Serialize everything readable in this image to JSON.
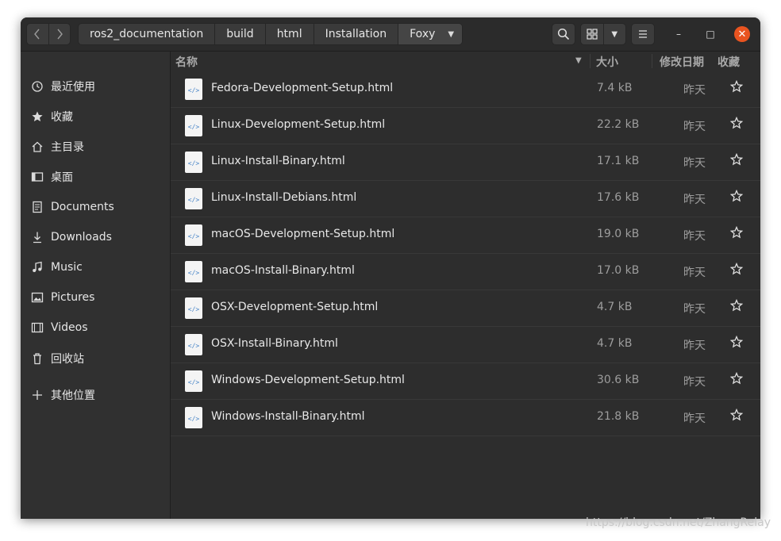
{
  "nav": {
    "back_icon": "chevron-left-icon",
    "forward_icon": "chevron-right-icon"
  },
  "path": [
    "ros2_documentation",
    "build",
    "html",
    "Installation",
    "Foxy"
  ],
  "toolbar": {
    "search_icon": "search-icon",
    "grid_icon": "grid-view-icon",
    "dropdown_icon": "chevron-down-icon",
    "menu_icon": "hamburger-menu-icon"
  },
  "window_controls": {
    "minimize": "–",
    "maximize": "□",
    "close": "✕"
  },
  "sidebar": {
    "items": [
      {
        "label": "最近使用",
        "icon": "clock-icon"
      },
      {
        "label": "收藏",
        "icon": "star-icon"
      },
      {
        "label": "主目录",
        "icon": "home-icon"
      },
      {
        "label": "桌面",
        "icon": "desktop-icon"
      },
      {
        "label": "Documents",
        "icon": "document-icon"
      },
      {
        "label": "Downloads",
        "icon": "download-icon"
      },
      {
        "label": "Music",
        "icon": "music-icon"
      },
      {
        "label": "Pictures",
        "icon": "picture-icon"
      },
      {
        "label": "Videos",
        "icon": "film-icon"
      },
      {
        "label": "回收站",
        "icon": "trash-icon"
      },
      {
        "label": "其他位置",
        "icon": "plus-icon"
      }
    ]
  },
  "columns": {
    "name": "名称",
    "size": "大小",
    "modified": "修改日期",
    "starred": "收藏"
  },
  "files": [
    {
      "name": "Fedora-Development-Setup.html",
      "size": "7.4 kB",
      "modified": "昨天"
    },
    {
      "name": "Linux-Development-Setup.html",
      "size": "22.2 kB",
      "modified": "昨天"
    },
    {
      "name": "Linux-Install-Binary.html",
      "size": "17.1 kB",
      "modified": "昨天"
    },
    {
      "name": "Linux-Install-Debians.html",
      "size": "17.6 kB",
      "modified": "昨天"
    },
    {
      "name": "macOS-Development-Setup.html",
      "size": "19.0 kB",
      "modified": "昨天"
    },
    {
      "name": "macOS-Install-Binary.html",
      "size": "17.0 kB",
      "modified": "昨天"
    },
    {
      "name": "OSX-Development-Setup.html",
      "size": "4.7 kB",
      "modified": "昨天"
    },
    {
      "name": "OSX-Install-Binary.html",
      "size": "4.7 kB",
      "modified": "昨天"
    },
    {
      "name": "Windows-Development-Setup.html",
      "size": "30.6 kB",
      "modified": "昨天"
    },
    {
      "name": "Windows-Install-Binary.html",
      "size": "21.8 kB",
      "modified": "昨天"
    }
  ],
  "watermark": "https://blog.csdn.net/ZhangRelay",
  "colors": {
    "accent": "#e95420",
    "background": "#2d2d2d",
    "sidebar": "#303030"
  }
}
